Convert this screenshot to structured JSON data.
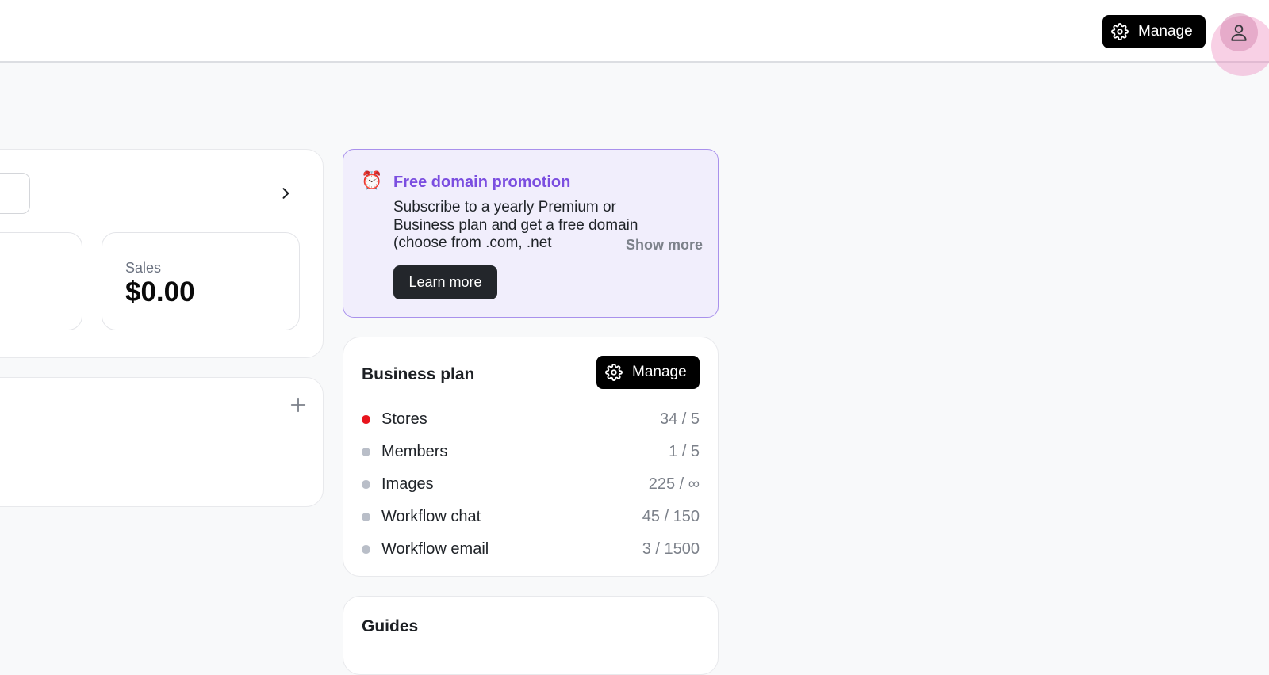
{
  "header": {
    "manage_label": "Manage"
  },
  "sales": {
    "label": "Sales",
    "value": "$0.00"
  },
  "promo": {
    "icon": "alarm-clock-icon",
    "title": "Free domain promotion",
    "text": "Subscribe to a yearly Premium or Business plan and get a free domain (choose from .com, .net",
    "show_more": "Show more",
    "learn_more": "Learn more"
  },
  "plan": {
    "title": "Business plan",
    "manage_label": "Manage",
    "usage": [
      {
        "label": "Stores",
        "value": "34 / 5",
        "status": "over",
        "color": "#e8141d"
      },
      {
        "label": "Members",
        "value": "1 / 5",
        "status": "ok",
        "color": "#b9bec8"
      },
      {
        "label": "Images",
        "value": "225 / ∞",
        "status": "ok",
        "color": "#b9bec8"
      },
      {
        "label": "Workflow chat",
        "value": "45 / 150",
        "status": "ok",
        "color": "#b9bec8"
      },
      {
        "label": "Workflow email",
        "value": "3 / 1500",
        "status": "ok",
        "color": "#b9bec8"
      }
    ]
  },
  "guides": {
    "title": "Guides"
  },
  "colors": {
    "accent_purple": "#7b4ee0",
    "promo_bg": "#f1eefc",
    "button_black": "#000000"
  }
}
